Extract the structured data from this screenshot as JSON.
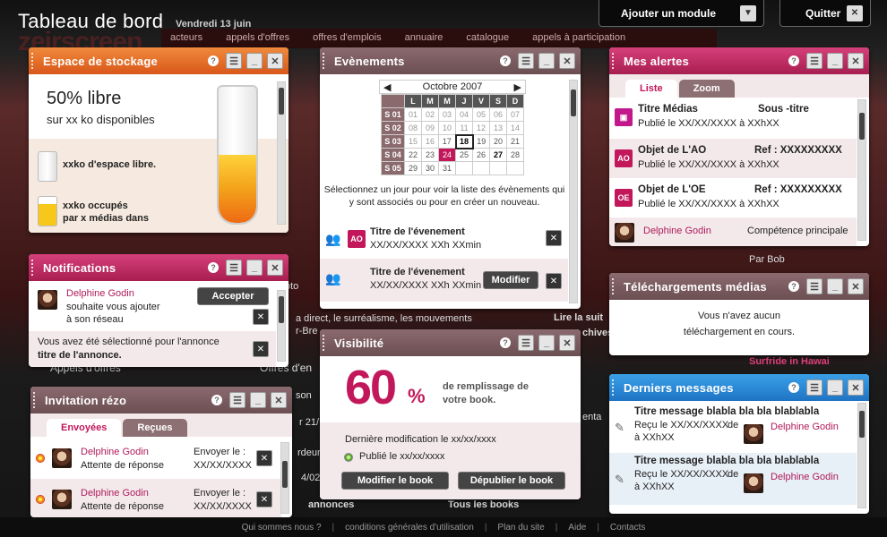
{
  "header": {
    "title": "Tableau de bord",
    "date": "Vendredi 13 juin",
    "add_module": "Ajouter un module",
    "quit": "Quitter"
  },
  "background": {
    "logo": "zeirscreen",
    "nav": [
      "acteurs",
      "appels d'offres",
      "offres d'emplois",
      "annuaire",
      "catalogue",
      "appels à participation"
    ],
    "snippets": [
      "oto",
      "a direct, le surréalisme, les mouvements",
      "r-Bre",
      "Lire la suit",
      "chives",
      "Par Bob",
      "Surfride in Hawai",
      "Offres d'en",
      "Appels d'offres",
      "son",
      "r 21/",
      "rdeur",
      "4/02/",
      "annonces",
      "Tous les books",
      "enta"
    ]
  },
  "footer": [
    "Qui sommes nous ?",
    "conditions générales d'utilisation",
    "Plan du site",
    "Aide",
    "Contacts"
  ],
  "storage": {
    "title": "Espace de stockage",
    "headline": "50% libre",
    "sub": "sur xx ko disponibles",
    "free": "xxko d'espace libre.",
    "used_line1": "xxko occupés",
    "used_line2": "par x médias dans",
    "fill_fraction": 0.5
  },
  "notifications": {
    "title": "Notifications",
    "item1": {
      "name": "Delphine Godin",
      "line1": "souhaite vous ajouter",
      "line2": "à son réseau",
      "accept": "Accepter"
    },
    "item2": {
      "line1": "Vous avez été sélectionné pour l'annonce",
      "line2": "titre de l'annonce."
    }
  },
  "invitation": {
    "title": "Invitation rézo",
    "tabs": [
      "Envoyées",
      "Reçues"
    ],
    "rows": [
      {
        "name": "Delphine Godin",
        "status": "Attente de réponse",
        "sent_label": "Envoyer le :",
        "date": "XX/XX/XXXX"
      },
      {
        "name": "Delphine Godin",
        "status": "Attente de réponse",
        "sent_label": "Envoyer le :",
        "date": "XX/XX/XXXX"
      }
    ]
  },
  "events": {
    "title": "Evènements",
    "month": "Octobre 2007",
    "day_headers": [
      "L",
      "M",
      "M",
      "J",
      "V",
      "S",
      "D"
    ],
    "weeks": [
      {
        "label": "S 01",
        "days": [
          "01",
          "02",
          "03",
          "04",
          "05",
          "06",
          "07"
        ]
      },
      {
        "label": "S 02",
        "days": [
          "08",
          "09",
          "10",
          "11",
          "12",
          "13",
          "14"
        ]
      },
      {
        "label": "S 03",
        "days": [
          "15",
          "16",
          "17",
          "18",
          "19",
          "20",
          "21"
        ]
      },
      {
        "label": "S 04",
        "days": [
          "22",
          "23",
          "24",
          "25",
          "26",
          "27",
          "28"
        ]
      },
      {
        "label": "S 05",
        "days": [
          "29",
          "30",
          "31",
          "",
          "",
          "",
          ""
        ]
      }
    ],
    "hint": "Sélectionnez un jour pour voir la liste des évènements qui y sont associés ou pour en créer un nouveau.",
    "items": [
      {
        "badge": "AO",
        "title": "Titre de l'évenement",
        "date": "XX/XX/XXXX XXh XXmin"
      },
      {
        "title": "Titre de l'évenement",
        "date": "XX/XX/XXXX XXh XXmin",
        "action": "Modifier"
      }
    ]
  },
  "visibility": {
    "title": "Visibilité",
    "percent": "60",
    "percent_sign": "%",
    "desc1": "de remplissage de",
    "desc2": "votre book.",
    "last_mod": "Dernière modification le xx/xx/xxxx",
    "published": "Publié le xx/xx/xxxx",
    "btn_modify": "Modifier le book",
    "btn_unpublish": "Dépublier le book"
  },
  "alerts": {
    "title": "Mes alertes",
    "tabs": [
      "Liste",
      "Zoom"
    ],
    "items": [
      {
        "badge": "media",
        "title": "Titre Médias",
        "ref": "Sous -titre",
        "sub": "Publié le XX/XX/XXXX à XXhXX",
        "color": "#c2188b"
      },
      {
        "badge": "AO",
        "title": "Objet de L'AO",
        "ref": "Ref : XXXXXXXXX",
        "sub": "Publié le XX/XX/XXXX à XXhXX",
        "color": "#c2185b"
      },
      {
        "badge": "OE",
        "title": "Objet de L'OE",
        "ref": "Ref : XXXXXXXXX",
        "sub": "Publié le XX/XX/XXXX à XXhXX",
        "color": "#c2185b"
      }
    ],
    "last": {
      "name": "Delphine Godin",
      "field": "Compétence principale"
    }
  },
  "downloads": {
    "title": "Téléchargements médias",
    "line1": "Vous n'avez aucun",
    "line2": "téléchargement en cours."
  },
  "messages": {
    "title": "Derniers messages",
    "items": [
      {
        "title": "Titre message blabla bla bla blablabla",
        "received": "Reçu le XX/XX/XXXX",
        "time": "à XXhXX",
        "from": "de",
        "name": "Delphine Godin"
      },
      {
        "title": "Titre message blabla bla bla blablabla",
        "received": "Reçu le XX/XX/XXXX",
        "time": "à XXhXX",
        "from": "de",
        "name": "Delphine Godin"
      }
    ]
  }
}
